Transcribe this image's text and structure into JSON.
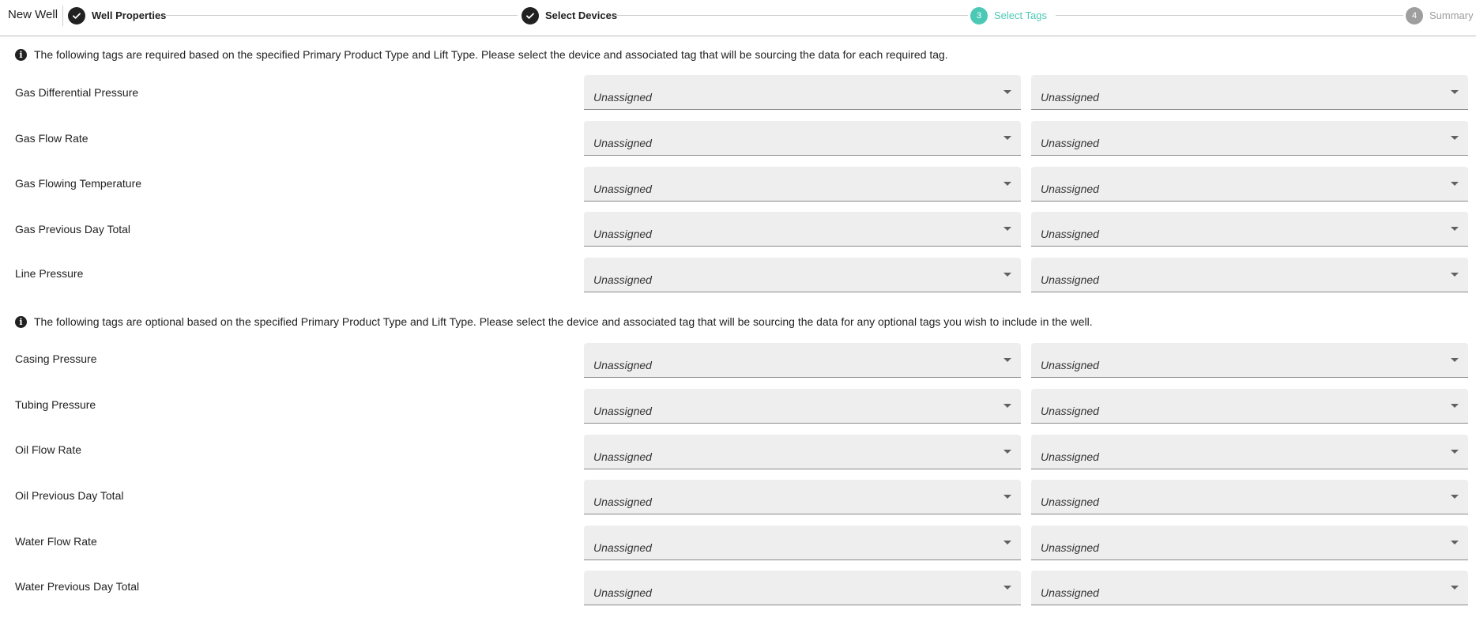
{
  "header": {
    "title": "New Well",
    "steps": [
      {
        "label": "Well Properties",
        "marker": "",
        "state": "done"
      },
      {
        "label": "Select Devices",
        "marker": "",
        "state": "done"
      },
      {
        "label": "Select Tags",
        "marker": "3",
        "state": "active"
      },
      {
        "label": "Summary",
        "marker": "4",
        "state": "pending"
      }
    ]
  },
  "required_section": {
    "info": "The following tags are required based on the specified Primary Product Type and Lift Type. Please select the device and associated tag that will be sourcing the data for each required tag.",
    "rows": [
      {
        "label": "Gas Differential Pressure",
        "device": "Unassigned",
        "tag": "Unassigned"
      },
      {
        "label": "Gas Flow Rate",
        "device": "Unassigned",
        "tag": "Unassigned"
      },
      {
        "label": "Gas Flowing Temperature",
        "device": "Unassigned",
        "tag": "Unassigned"
      },
      {
        "label": "Gas Previous Day Total",
        "device": "Unassigned",
        "tag": "Unassigned"
      },
      {
        "label": "Line Pressure",
        "device": "Unassigned",
        "tag": "Unassigned"
      }
    ]
  },
  "optional_section": {
    "info": "The following tags are optional based on the specified Primary Product Type and Lift Type. Please select the device and associated tag that will be sourcing the data for any optional tags you wish to include in the well.",
    "rows": [
      {
        "label": "Casing Pressure",
        "device": "Unassigned",
        "tag": "Unassigned"
      },
      {
        "label": "Tubing Pressure",
        "device": "Unassigned",
        "tag": "Unassigned"
      },
      {
        "label": "Oil Flow Rate",
        "device": "Unassigned",
        "tag": "Unassigned"
      },
      {
        "label": "Oil Previous Day Total",
        "device": "Unassigned",
        "tag": "Unassigned"
      },
      {
        "label": "Water Flow Rate",
        "device": "Unassigned",
        "tag": "Unassigned"
      },
      {
        "label": "Water Previous Day Total",
        "device": "Unassigned",
        "tag": "Unassigned"
      }
    ]
  },
  "colors": {
    "accent": "#4cc9b5",
    "done": "#212121",
    "pending": "#9e9e9e",
    "field_bg": "#eeeeee"
  },
  "icons": {
    "step_done": "check-icon",
    "info": "info-icon",
    "dropdown": "caret-down-icon"
  }
}
